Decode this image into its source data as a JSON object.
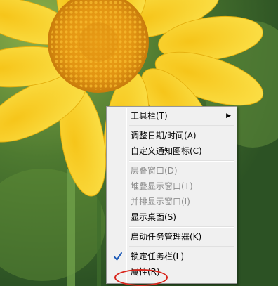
{
  "menu": {
    "toolbars": "工具栏(T)",
    "adjust_datetime": "调整日期/时间(A)",
    "customize_notify": "自定义通知图标(C)",
    "cascade": "层叠窗口(D)",
    "stacked": "堆叠显示窗口(T)",
    "side_by_side": "并排显示窗口(I)",
    "show_desktop": "显示桌面(S)",
    "task_manager": "启动任务管理器(K)",
    "lock_taskbar": "锁定任务栏(L)",
    "properties": "属性(R)"
  },
  "icons": {
    "submenu": "submenu-arrow-icon",
    "check": "checkmark-icon"
  },
  "colors": {
    "menu_bg": "#f0f0f0",
    "disabled_text": "#8d8d8d",
    "check": "#1e5bb8",
    "highlight": "#d9261c",
    "petal": "#f7cf1c",
    "flower_center": "#e8a113"
  }
}
